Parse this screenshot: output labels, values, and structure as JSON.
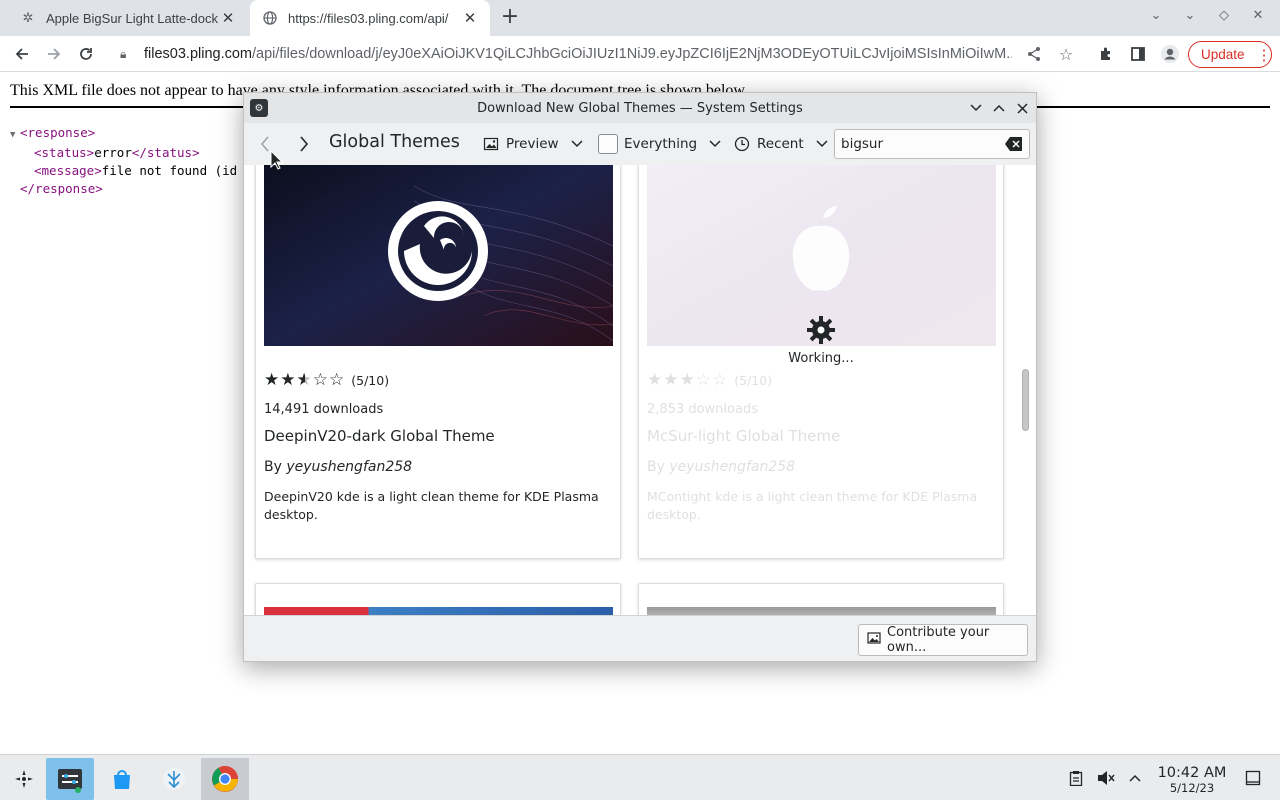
{
  "browser": {
    "tabs": [
      {
        "title": "Apple BigSur Light Latte-dock",
        "favicon": "kde-store-icon",
        "active": false
      },
      {
        "title": "https://files03.pling.com/api/",
        "favicon": "globe-icon",
        "active": true
      }
    ],
    "url_host": "files03.pling.com",
    "url_path": "/api/files/download/j/eyJ0eXAiOiJKV1QiLCJhbGciOiJIUzI1NiJ9.eyJpZCI6IjE2NjM3ODEyOTUiLCJvIjoiMSIsInMiOiIwM...",
    "update_label": "Update"
  },
  "xml_page": {
    "header": "This XML file does not appear to have any style information associated with it. The document tree is shown below.",
    "lines": {
      "response_open": "<response>",
      "status_open": "<status>",
      "status_value": "error",
      "status_close": "</status>",
      "message_open": "<message>",
      "message_value": "file not found (id",
      "response_close": "</response>"
    }
  },
  "dialog": {
    "window_title": "Download New Global Themes — System Settings",
    "page_title": "Global Themes",
    "view_mode": "Preview",
    "filter": "Everything",
    "sort": "Recent",
    "search_value": "bigsur",
    "contribute_label": "Contribute your own...",
    "working_label": "Working...",
    "cards": [
      {
        "name": "DeepinV20-dark Global Theme",
        "author_prefix": "By",
        "author": "yeyushengfan258",
        "rating_text": "(5/10)",
        "rating": 5,
        "downloads": "14,491 downloads",
        "description": "DeepinV20 kde is a light clean theme for KDE Plasma desktop."
      },
      {
        "name": "McSur-light Global Theme",
        "author_prefix": "By",
        "author": "yeyushengfan258",
        "rating_text": "(5/10)",
        "rating": 5,
        "downloads": "2,853 downloads",
        "description": "MContight kde is a light clean theme for KDE Plasma desktop."
      }
    ]
  },
  "taskbar": {
    "time": "10:42 AM",
    "date": "5/12/23"
  },
  "colors": {
    "accent": "#7ec0ea",
    "update_red": "#d93025",
    "xml_tag": "#881280"
  }
}
